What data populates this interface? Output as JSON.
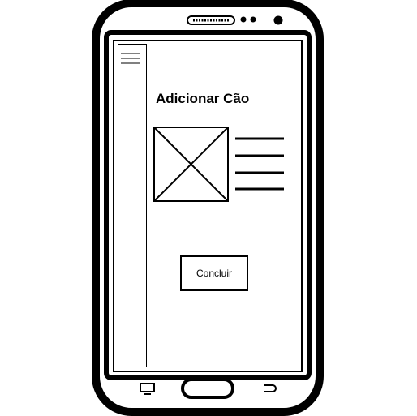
{
  "screen": {
    "title": "Adicionar Cão",
    "confirm_button_label": "Concluir"
  },
  "sidebar": {
    "menu_icon": "hamburger-icon"
  },
  "content": {
    "image_placeholder_icon": "image-placeholder-icon",
    "text_lines_count": 4
  },
  "device": {
    "nav_icons": [
      "recent-apps-icon",
      "home-button",
      "back-icon"
    ]
  }
}
